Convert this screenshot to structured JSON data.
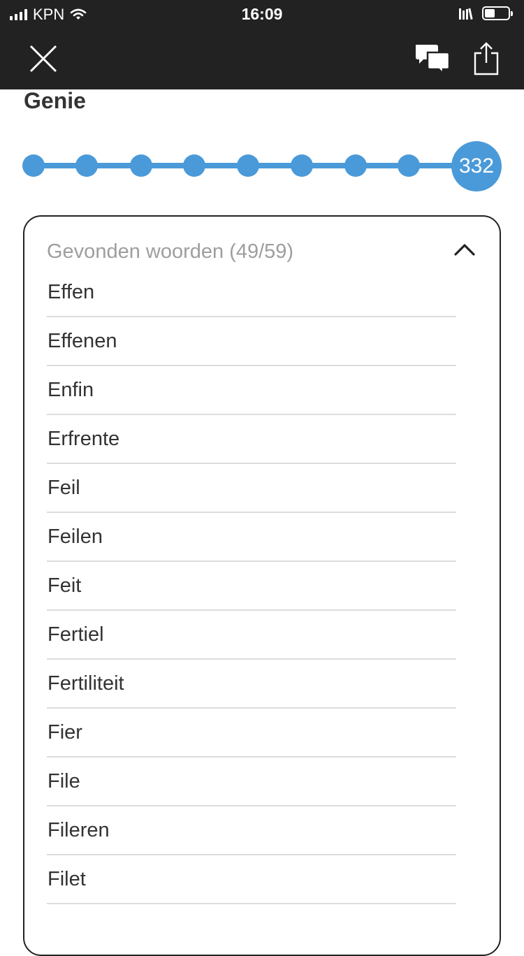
{
  "status_bar": {
    "carrier": "KPN",
    "time": "16:09"
  },
  "nav": {
    "close_icon": "close-icon",
    "chat_icon": "chat-bubbles-icon",
    "share_icon": "share-icon"
  },
  "page": {
    "title": "Genie"
  },
  "progress": {
    "levels_total": 9,
    "current_level": 9,
    "score": "332",
    "color": "#4a9ad9"
  },
  "found_words": {
    "header": "Gevonden woorden (49/59)",
    "expanded": true,
    "words": [
      "Effen",
      "Effenen",
      "Enfin",
      "Erfrente",
      "Feil",
      "Feilen",
      "Feit",
      "Fertiel",
      "Fertiliteit",
      "Fier",
      "File",
      "Fileren",
      "Filet"
    ]
  }
}
